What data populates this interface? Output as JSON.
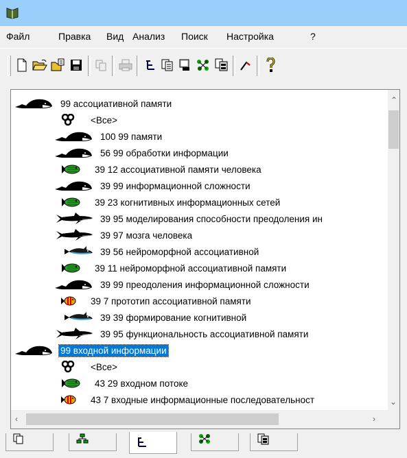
{
  "menu": [
    "Файл",
    "Правка",
    "Вид",
    "Анализ",
    "Поиск",
    "Настройка",
    "?"
  ],
  "toolbar": {
    "buttons": [
      "new-document-icon",
      "open-folder-icon",
      "open-database-icon",
      "save-icon",
      "copy-icon",
      "print-icon",
      "tree-icon",
      "document-list-icon",
      "monitor-icon",
      "network-icon",
      "report-icon",
      "graph-icon",
      "help-icon"
    ]
  },
  "tree": {
    "rows": [
      {
        "label": "99 ассоциативной памяти",
        "icon": "whale-icon",
        "level": 0
      },
      {
        "label": "<Все>",
        "icon": "links-icon",
        "level": 1
      },
      {
        "label": "100 99 памяти",
        "icon": "whale-icon",
        "level": 1
      },
      {
        "label": "56 99 обработки информации",
        "icon": "whale-icon",
        "level": 1
      },
      {
        "label": "39 12 ассоциативной памяти человека",
        "icon": "fish-green-icon",
        "level": 1
      },
      {
        "label": "39 99 информационной сложности",
        "icon": "whale-icon",
        "level": 1
      },
      {
        "label": "39 23 когнитивных информационных сетей",
        "icon": "fish-green-icon",
        "level": 1
      },
      {
        "label": "39 95 моделирования способности преодоления ин",
        "icon": "shark-icon",
        "level": 1
      },
      {
        "label": "39 97 мозга человека",
        "icon": "shark-icon",
        "level": 1
      },
      {
        "label": "39 56 нейроморфной ассоциативной",
        "icon": "dolphin-icon",
        "level": 1
      },
      {
        "label": "39 11 нейроморфной ассоциативной памяти",
        "icon": "fish-green-icon",
        "level": 1
      },
      {
        "label": "39 99 преодоления информационной сложности",
        "icon": "whale-icon",
        "level": 1
      },
      {
        "label": "39 7 прототип ассоциативной памяти",
        "icon": "fish-orange-icon",
        "level": 1
      },
      {
        "label": "39 39 формирование когнитивной",
        "icon": "dolphin-icon",
        "level": 1
      },
      {
        "label": "39 95 функциональность ассоциативной памяти",
        "icon": "shark-icon",
        "level": 1
      },
      {
        "label": "99 входной информации",
        "icon": "whale-icon",
        "level": 0,
        "selected": true
      },
      {
        "label": "<Все>",
        "icon": "links-icon",
        "level": 1
      },
      {
        "label": "43 29 входном потоке",
        "icon": "fish-green-icon",
        "level": 1
      },
      {
        "label": "43 7 входные информационные последовательност",
        "icon": "fish-orange-icon",
        "level": 1
      }
    ]
  },
  "tabs": [
    {
      "icon": "documents-tab-icon"
    },
    {
      "icon": "hierarchy-tab-icon"
    },
    {
      "icon": "tree-tab-icon",
      "active": true
    },
    {
      "icon": "network-tab-icon"
    },
    {
      "icon": "report-tab-icon"
    }
  ],
  "colors": {
    "titlebar": "#99cffa",
    "selection": "#0078d7"
  }
}
